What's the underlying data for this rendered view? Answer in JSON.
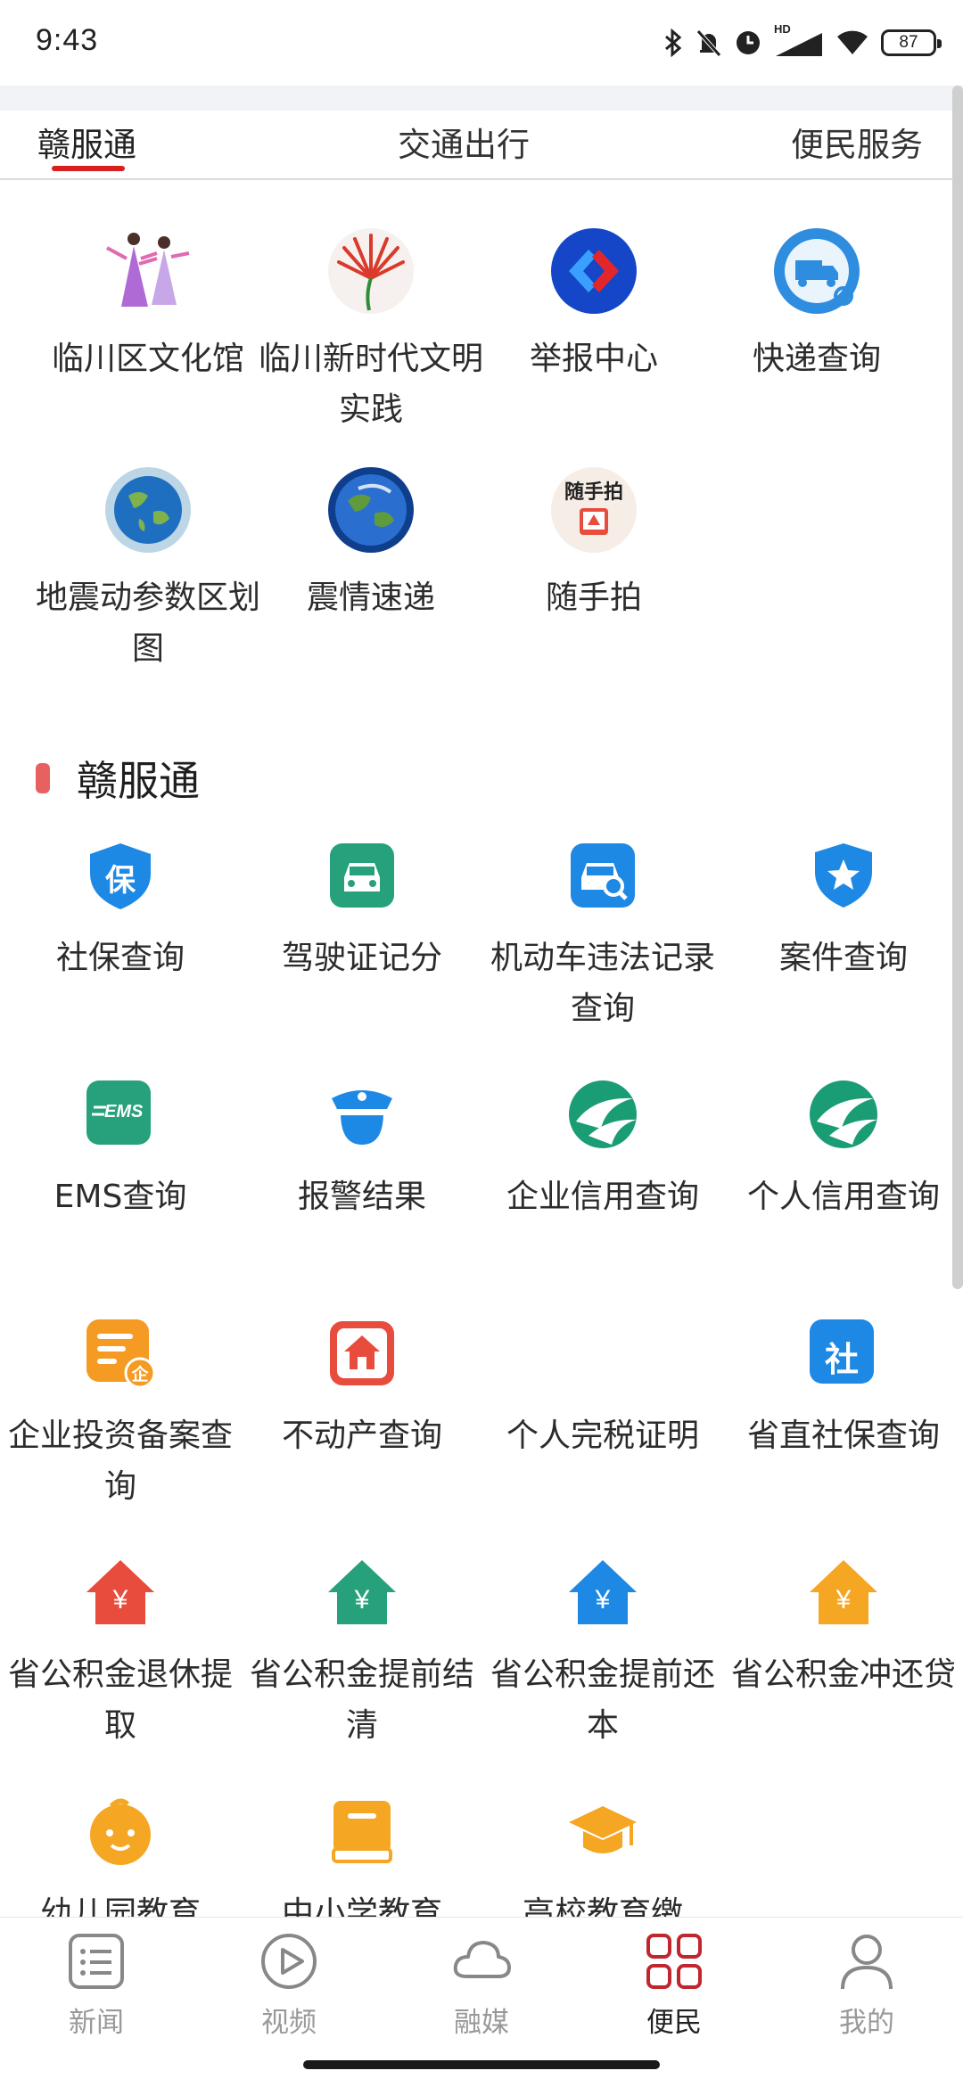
{
  "status_bar": {
    "time": "9:43",
    "network": "HD",
    "battery": "87"
  },
  "tabs": [
    {
      "label": "赣服通",
      "active": true
    },
    {
      "label": "交通出行",
      "active": false
    },
    {
      "label": "便民服务",
      "active": false
    }
  ],
  "top_items": [
    {
      "label": "临川区文化馆",
      "icon": "opera-dancers-icon"
    },
    {
      "label": "临川新时代文明实践",
      "icon": "red-fan-logo-icon"
    },
    {
      "label": "举报中心",
      "icon": "report-center-icon"
    },
    {
      "label": "快递查询",
      "icon": "delivery-truck-icon"
    },
    {
      "label": "地震动参数区划图",
      "icon": "globe-icon"
    },
    {
      "label": "震情速递",
      "icon": "earth-icon"
    },
    {
      "label": "随手拍",
      "icon": "snapshot-icon",
      "icon_text": "随手拍"
    }
  ],
  "section": {
    "title": "赣服通"
  },
  "services": [
    {
      "label": "社保查询",
      "icon": "shield-bao-icon",
      "color": "#1e88e5",
      "glyph": "保"
    },
    {
      "label": "驾驶证记分",
      "icon": "car-icon",
      "color": "#26a17b"
    },
    {
      "label": "机动车违法记录查询",
      "icon": "car-search-icon",
      "color": "#1e88e5"
    },
    {
      "label": "案件查询",
      "icon": "star-shield-icon",
      "color": "#1e88e5"
    },
    {
      "label": "EMS查询",
      "icon": "ems-icon",
      "color": "#26a17b",
      "glyph": "EMS"
    },
    {
      "label": "报警结果",
      "icon": "police-icon",
      "color": "#1e88e5"
    },
    {
      "label": "企业信用查询",
      "icon": "credit-icon",
      "color": "#1a9c74"
    },
    {
      "label": "个人信用查询",
      "icon": "credit-icon",
      "color": "#1a9c74"
    },
    {
      "label": "企业投资备案查询",
      "icon": "enterprise-doc-icon",
      "color": "#f59a23",
      "glyph": "企"
    },
    {
      "label": "不动产查询",
      "icon": "house-icon",
      "color": "#e74c3c"
    },
    {
      "label": "个人完税证明",
      "icon": "none"
    },
    {
      "label": "省直社保查询",
      "icon": "she-icon",
      "color": "#1e88e5",
      "glyph": "社"
    },
    {
      "label": "省公积金退休提取",
      "icon": "fund-house-icon",
      "color": "#e74c3c",
      "glyph": "¥"
    },
    {
      "label": "省公积金提前结清",
      "icon": "fund-house-icon",
      "color": "#26a17b",
      "glyph": "¥"
    },
    {
      "label": "省公积金提前还本",
      "icon": "fund-house-icon",
      "color": "#1e88e5",
      "glyph": "¥"
    },
    {
      "label": "省公积金冲还贷",
      "icon": "fund-house-icon",
      "color": "#f5a623",
      "glyph": "¥"
    },
    {
      "label": "幼儿园教育",
      "icon": "baby-icon",
      "color": "#f5a623"
    },
    {
      "label": "中小学教育",
      "icon": "book-icon",
      "color": "#f5a623"
    },
    {
      "label": "高校教育缴",
      "icon": "graduation-cap-icon",
      "color": "#f5a623"
    }
  ],
  "bottom_nav": [
    {
      "label": "新闻",
      "icon": "news-icon",
      "active": false
    },
    {
      "label": "视频",
      "icon": "play-icon",
      "active": false
    },
    {
      "label": "融媒",
      "icon": "cloud-icon",
      "active": false
    },
    {
      "label": "便民",
      "icon": "grid-icon",
      "active": true
    },
    {
      "label": "我的",
      "icon": "user-icon",
      "active": false
    }
  ]
}
